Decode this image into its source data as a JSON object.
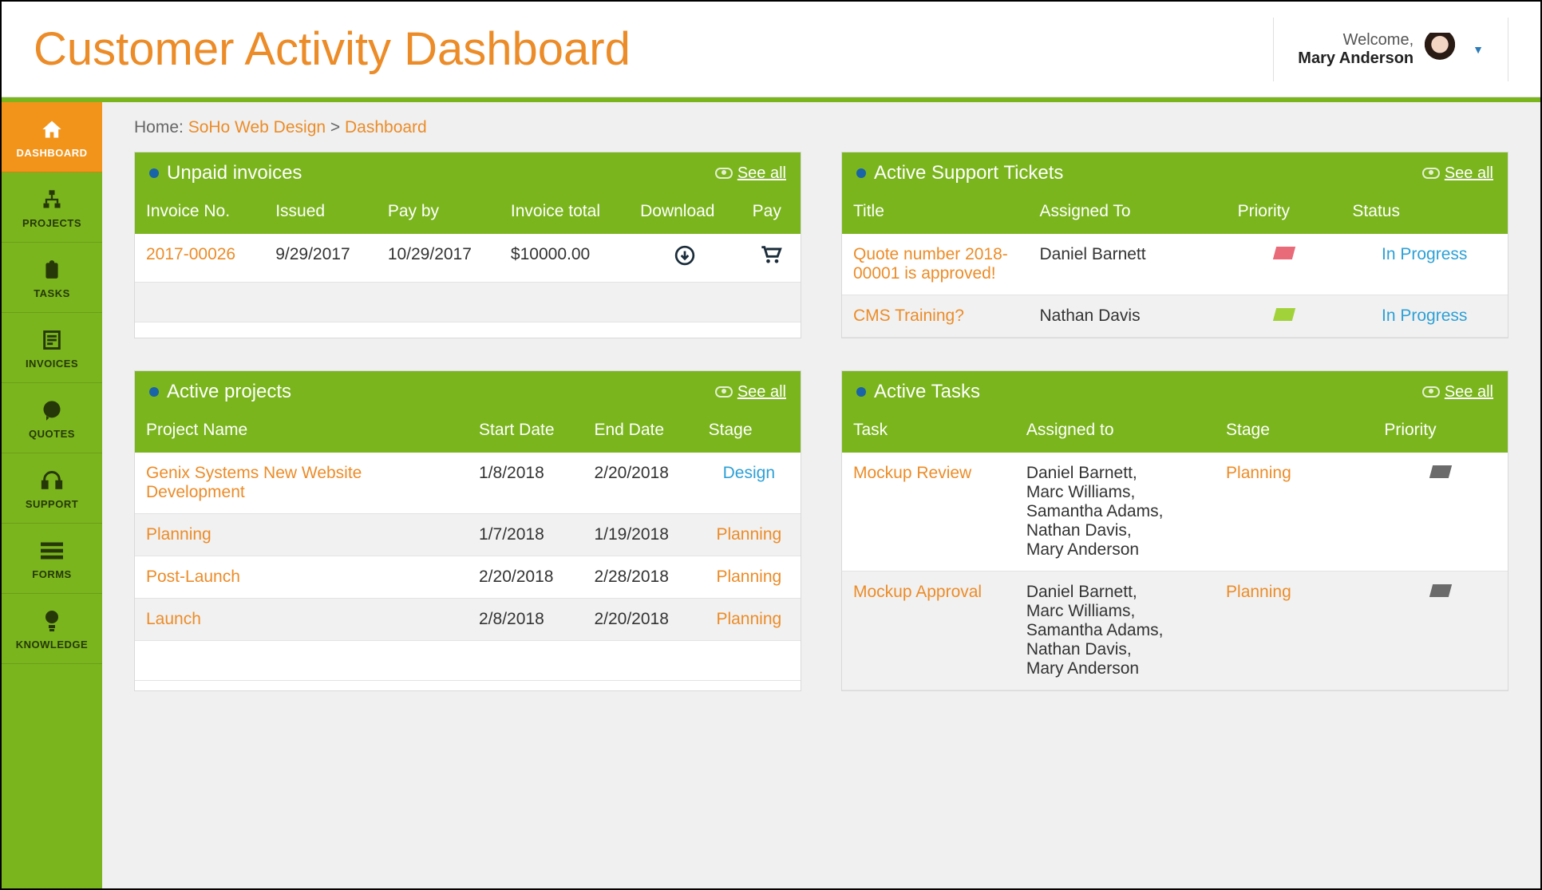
{
  "header": {
    "title": "Customer Activity Dashboard",
    "welcome": "Welcome,",
    "user_name": "Mary Anderson"
  },
  "sidebar": {
    "items": [
      {
        "label": "DASHBOARD",
        "icon": "home"
      },
      {
        "label": "PROJECTS",
        "icon": "projects"
      },
      {
        "label": "TASKS",
        "icon": "tasks"
      },
      {
        "label": "INVOICES",
        "icon": "invoices"
      },
      {
        "label": "QUOTES",
        "icon": "quotes"
      },
      {
        "label": "SUPPORT",
        "icon": "support"
      },
      {
        "label": "FORMS",
        "icon": "forms"
      },
      {
        "label": "KNOWLEDGE",
        "icon": "knowledge"
      }
    ]
  },
  "breadcrumb": {
    "home_label": "Home: ",
    "org": "SoHo Web Design",
    "separator": " > ",
    "page": "Dashboard"
  },
  "see_all_label": "See all",
  "invoices_panel": {
    "title": "Unpaid invoices",
    "columns": [
      "Invoice No.",
      "Issued",
      "Pay by",
      "Invoice total",
      "Download",
      "Pay"
    ],
    "rows": [
      {
        "no": "2017-00026",
        "issued": "9/29/2017",
        "payby": "10/29/2017",
        "total": "$10000.00"
      }
    ]
  },
  "tickets_panel": {
    "title": "Active Support Tickets",
    "columns": [
      "Title",
      "Assigned To",
      "Priority",
      "Status"
    ],
    "rows": [
      {
        "title": "Quote number 2018-00001 is approved!",
        "assigned": "Daniel Barnett",
        "priority": "red",
        "status": "In Progress"
      },
      {
        "title": "CMS Training?",
        "assigned": "Nathan Davis",
        "priority": "green",
        "status": "In Progress"
      }
    ]
  },
  "projects_panel": {
    "title": "Active projects",
    "columns": [
      "Project Name",
      "Start Date",
      "End Date",
      "Stage"
    ],
    "rows": [
      {
        "name": "Genix Systems New Website Development",
        "start": "1/8/2018",
        "end": "2/20/2018",
        "stage": "Design",
        "stage_style": "blue"
      },
      {
        "name": "Planning",
        "start": "1/7/2018",
        "end": "1/19/2018",
        "stage": "Planning",
        "stage_style": "orange"
      },
      {
        "name": "Post-Launch",
        "start": "2/20/2018",
        "end": "2/28/2018",
        "stage": "Planning",
        "stage_style": "orange"
      },
      {
        "name": "Launch",
        "start": "2/8/2018",
        "end": "2/20/2018",
        "stage": "Planning",
        "stage_style": "orange"
      }
    ]
  },
  "tasks_panel": {
    "title": "Active Tasks",
    "columns": [
      "Task",
      "Assigned to",
      "Stage",
      "Priority"
    ],
    "rows": [
      {
        "task": "Mockup Review",
        "assigned": "Daniel Barnett, Marc Williams, Samantha Adams, Nathan Davis, Mary Anderson",
        "stage": "Planning",
        "priority": "gray"
      },
      {
        "task": "Mockup Approval",
        "assigned": "Daniel Barnett, Marc Williams, Samantha Adams, Nathan Davis, Mary Anderson",
        "stage": "Planning",
        "priority": "gray"
      }
    ]
  }
}
